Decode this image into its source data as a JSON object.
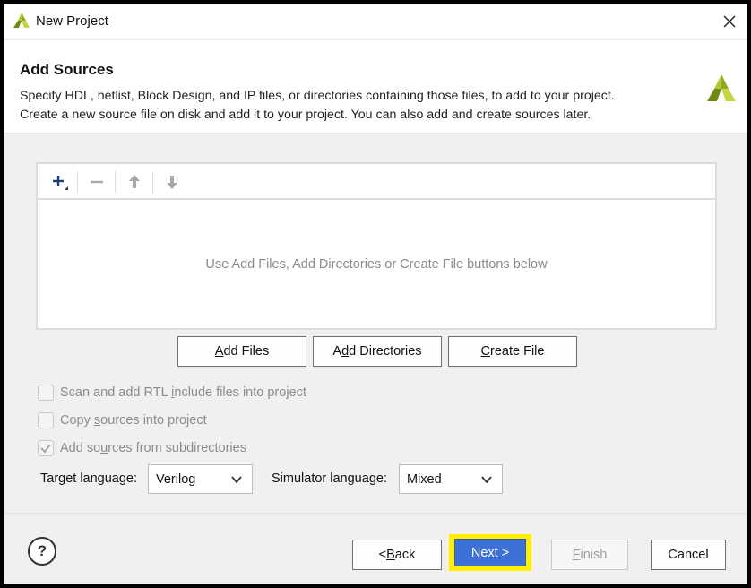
{
  "window": {
    "title": "New Project"
  },
  "header": {
    "title": "Add Sources",
    "description_line1": "Specify HDL, netlist, Block Design, and IP files, or directories containing those files, to add to your project.",
    "description_line2": "Create a new source file on disk and add it to your project. You can also add and create sources later."
  },
  "toolbar": {
    "icons": [
      "add-icon",
      "remove-icon",
      "move-up-icon",
      "move-down-icon"
    ]
  },
  "files_panel": {
    "empty_message": "Use Add Files, Add Directories or Create File buttons below"
  },
  "buttons": {
    "add_files": {
      "pre": "",
      "u": "A",
      "post": "dd Files"
    },
    "add_directories": {
      "pre": "A",
      "u": "d",
      "post": "d Directories"
    },
    "create_file": {
      "pre": "",
      "u": "C",
      "post": "reate File"
    }
  },
  "options": {
    "scan_rtl": {
      "label_pre": "Scan and add RTL ",
      "label_u": "i",
      "label_post": "nclude files into project",
      "checked": false,
      "enabled": false
    },
    "copy_sources": {
      "label_pre": "Copy ",
      "label_u": "s",
      "label_post": "ources into project",
      "checked": false,
      "enabled": false
    },
    "add_subdirs": {
      "label_pre": "Add so",
      "label_u": "u",
      "label_post": "rces from subdirectories",
      "checked": true,
      "enabled": false
    }
  },
  "language": {
    "target_label": "Target language:",
    "target_value": "Verilog",
    "simulator_label": "Simulator language:",
    "simulator_value": "Mixed"
  },
  "footer": {
    "help": "?",
    "back": {
      "pre": "< ",
      "u": "B",
      "post": "ack"
    },
    "next": {
      "pre": "",
      "u": "N",
      "post": "ext >"
    },
    "finish": {
      "pre": "",
      "u": "F",
      "post": "inish"
    },
    "cancel": "Cancel"
  },
  "colors": {
    "accent": "#3c72d8",
    "highlight": "#ffee00",
    "logo_green": "#8fa81f"
  }
}
